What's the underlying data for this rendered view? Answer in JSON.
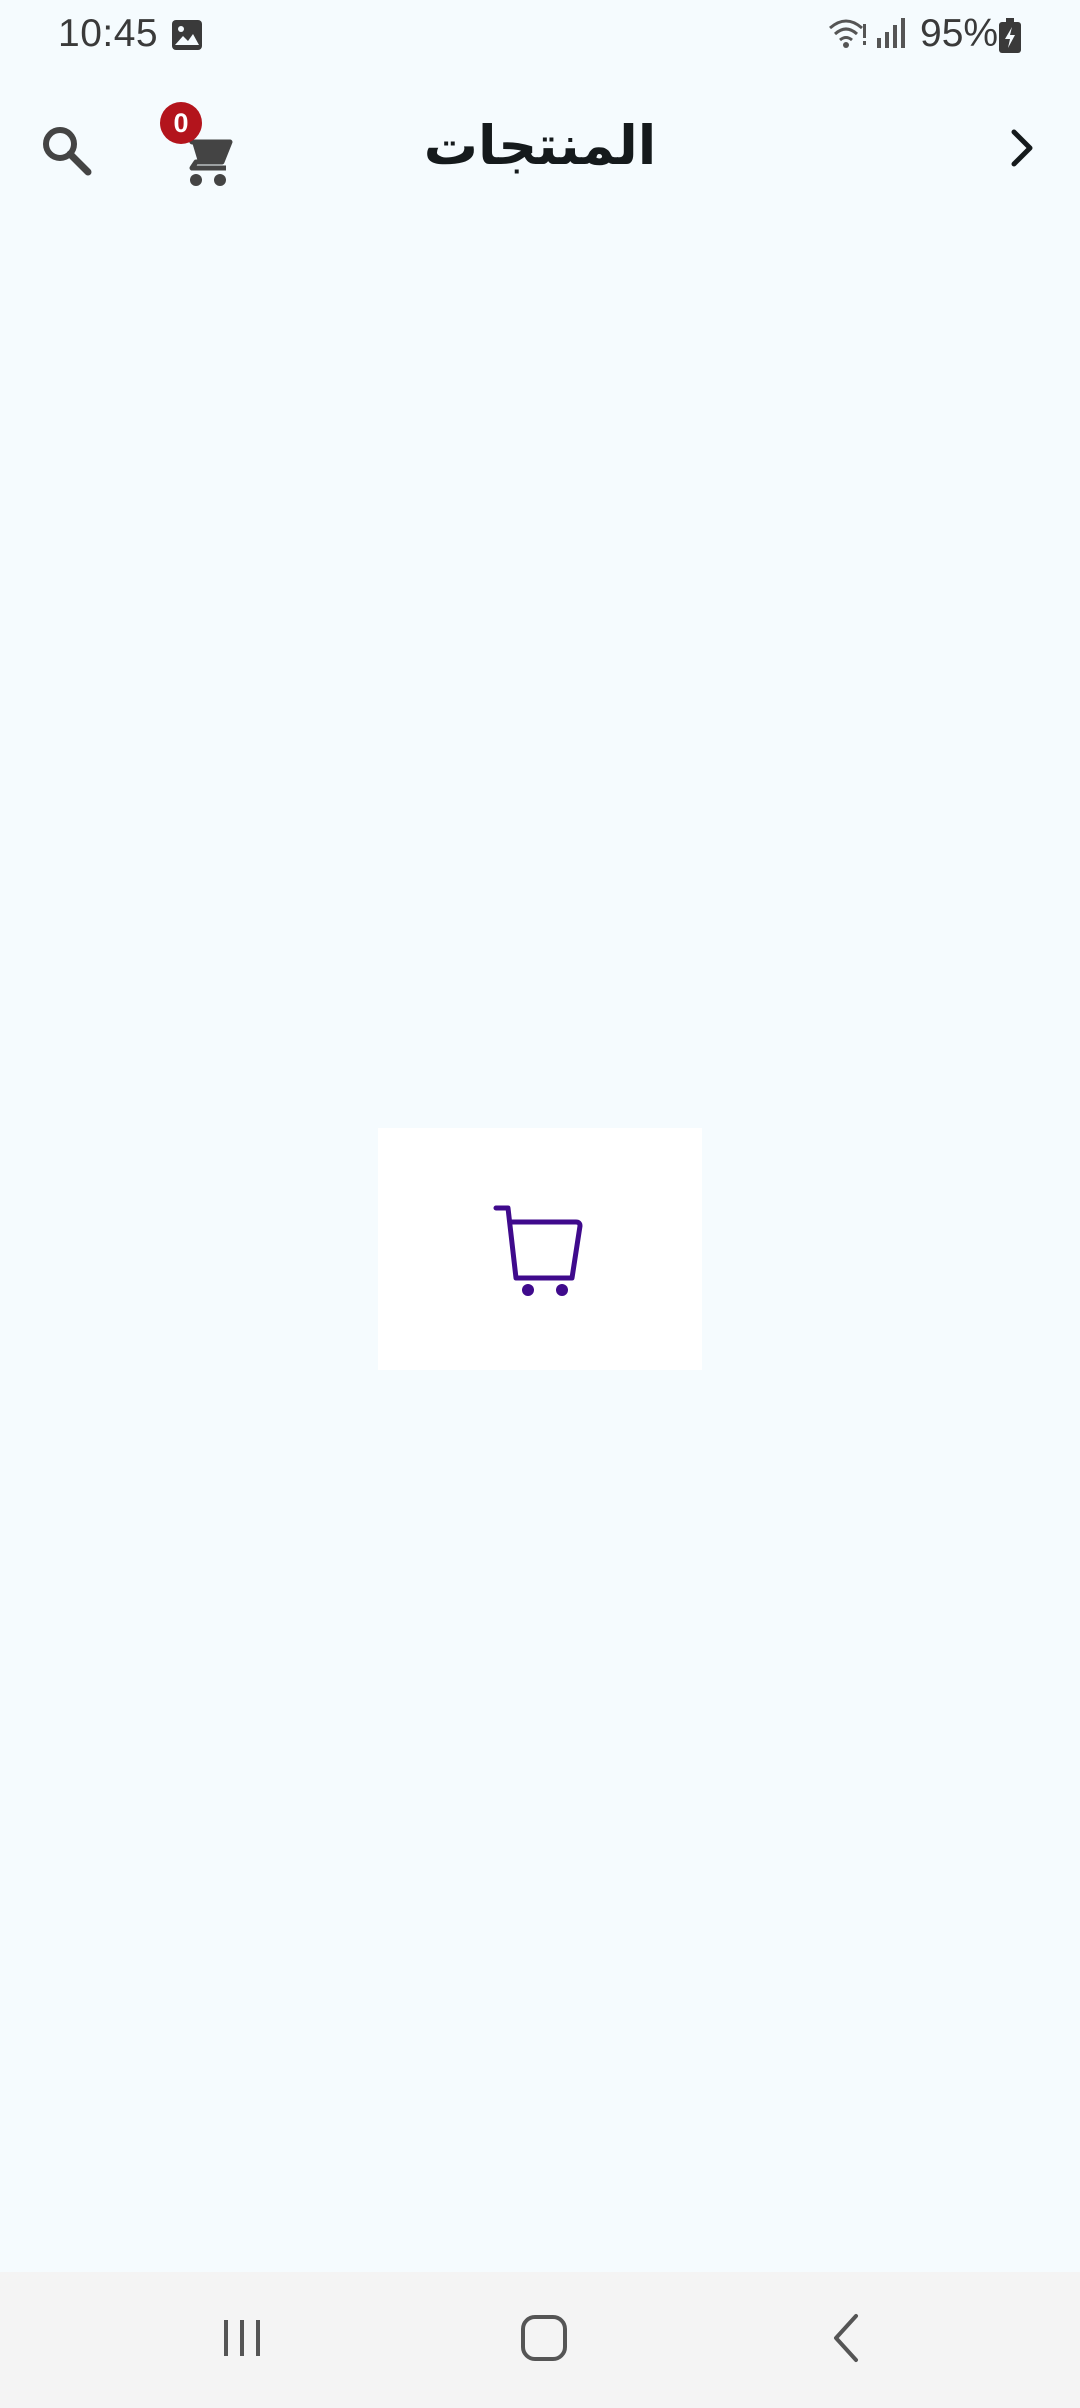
{
  "status_bar": {
    "time": "10:45",
    "battery_percent": "95%",
    "icons": [
      "gallery-icon",
      "wifi-icon",
      "signal-icon",
      "battery-charging-icon"
    ]
  },
  "app_bar": {
    "title": "المنتجات",
    "cart_count": "0",
    "icons": [
      "search-icon",
      "cart-icon",
      "chevron-right-icon"
    ]
  },
  "content": {
    "loader_icon": "cart-outline-icon",
    "loader_color": "#3f0a8c"
  },
  "nav_bar": {
    "icons": [
      "recents-icon",
      "home-icon",
      "back-icon"
    ]
  },
  "colors": {
    "background": "#f5fbfe",
    "badge": "#b3141c",
    "nav_background": "#f4f4f4"
  }
}
